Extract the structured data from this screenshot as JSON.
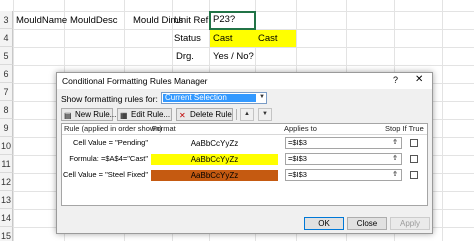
{
  "sheet": {
    "rows": [
      "3",
      "4",
      "5",
      "6",
      "7",
      "8",
      "9",
      "10",
      "11",
      "12",
      "13",
      "14",
      "15",
      "16"
    ],
    "cells": {
      "mould_name": "MouldName",
      "mould_desc": "MouldDesc",
      "mould_dims": "Mould Dims",
      "unit_ref_label": "Unit Ref.",
      "unit_ref_value": "P23?",
      "status_label": "Status",
      "status_value_1": "Cast",
      "status_value_2": "Cast",
      "drg_label": "Drg.",
      "drg_value": "Yes / No?"
    }
  },
  "dialog": {
    "title": "Conditional Formatting Rules Manager",
    "help_icon": "?",
    "close_icon": "✕",
    "show_rules_label": "Show formatting rules for:",
    "show_rules_value": "Current Selection",
    "toolbar": {
      "new_rule": "New Rule...",
      "edit_rule": "Edit Rule...",
      "delete_rule": "Delete Rule",
      "move_up": "▲",
      "move_down": "▼"
    },
    "columns": {
      "rule": "Rule (applied in order shown)",
      "format": "Format",
      "applies_to": "Applies to",
      "stop_if_true": "Stop If True"
    },
    "rules": [
      {
        "rule": "Cell Value = \"Pending\"",
        "preview": "AaBbCcYyZz",
        "bg": "#ffffff",
        "fg": "#000000",
        "applies_to": "=$I$3",
        "stop_if_true": false
      },
      {
        "rule": "Formula: =$A$4=\"Cast\"",
        "preview": "AaBbCcYyZz",
        "bg": "#ffff00",
        "fg": "#000000",
        "applies_to": "=$I$3",
        "stop_if_true": false
      },
      {
        "rule": "Cell Value = \"Steel Fixed\"",
        "preview": "AaBbCcYyZz",
        "bg": "#c55a11",
        "fg": "#000000",
        "applies_to": "=$I$3",
        "stop_if_true": false
      }
    ],
    "buttons": {
      "ok": "OK",
      "close": "Close",
      "apply": "Apply"
    }
  },
  "colors": {
    "selection_border": "#217346",
    "yellow_fill": "#ffff00",
    "orange_fill": "#c55a11",
    "highlight": "#3399ff"
  }
}
